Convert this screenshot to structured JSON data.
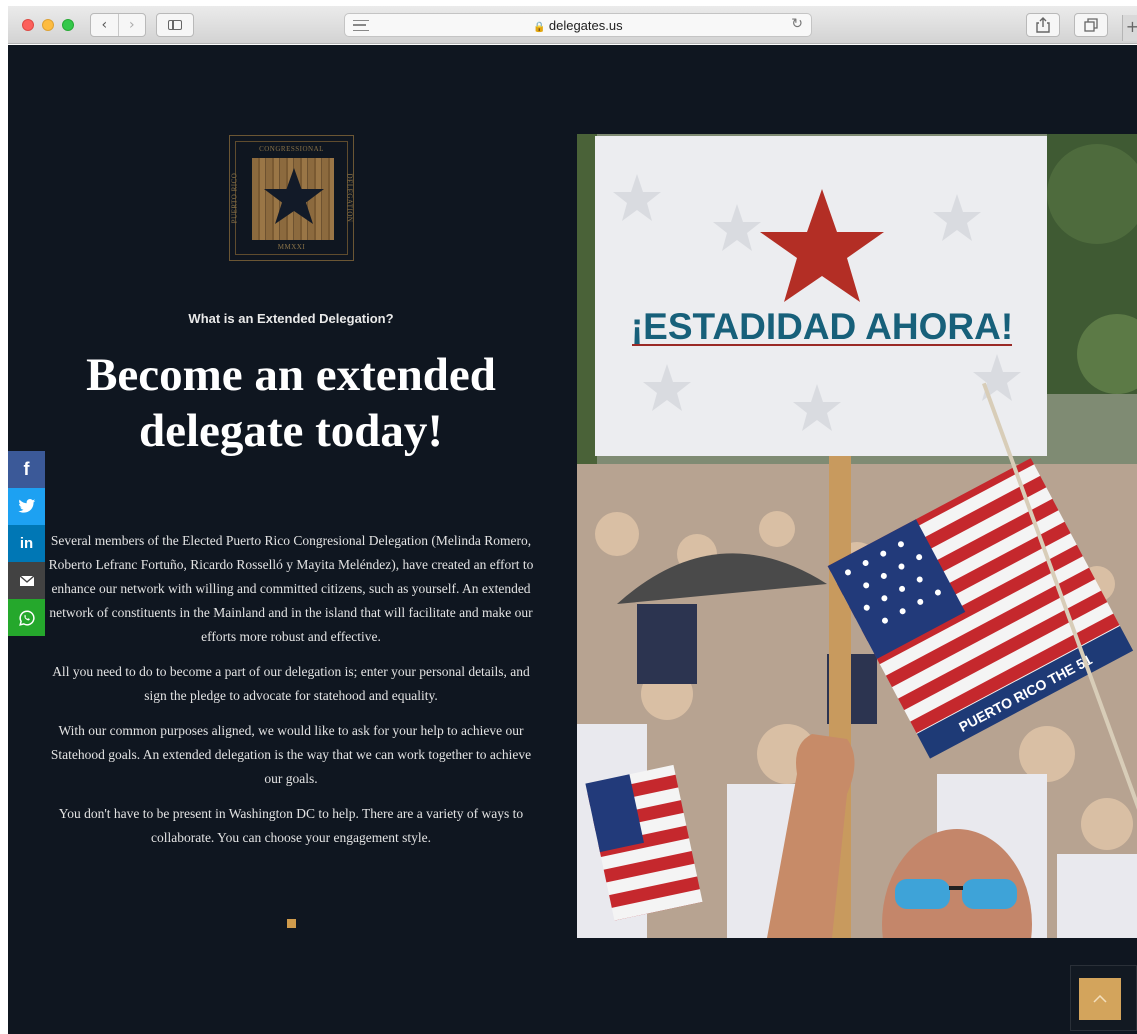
{
  "browser": {
    "url": "delegates.us",
    "back_glyph": "‹",
    "forward_glyph": "›",
    "reload_glyph": "↻",
    "plus_glyph": "+"
  },
  "logo": {
    "top": "CONGRESSIONAL",
    "left": "PUERTO RICO",
    "right": "DELEGATION",
    "bottom": "MMXXI"
  },
  "hero": {
    "eyebrow": "What is an Extended Delegation?",
    "headline_line1": "Become an extended",
    "headline_line2": "delegate today!"
  },
  "body": {
    "p1": "Several members of the Elected Puerto Rico Congresional Delegation (Melinda Romero, Roberto Lefranc Fortuño, Ricardo Rosselló y Mayita Meléndez), have created an effort to enhance our network with willing and committed citizens, such as yourself. An extended network of constituents in the Mainland and in the island that will facilitate and make our efforts more robust and effective.",
    "p2": "All you need to do to become a part of our delegation is; enter your personal details, and sign the pledge to advocate for statehood and equality.",
    "p3": "With our common purposes aligned, we would like to ask for your help to achieve our Statehood goals.  An extended delegation is the way that we can work together to achieve our goals.",
    "p4": "You don't have to be present in Washington DC to help. There are a variety of ways to collaborate. You can choose your engagement style."
  },
  "social": {
    "facebook": "f",
    "linkedin": "in"
  },
  "photo": {
    "sign_text": "¡ESTADIDAD AHORA!",
    "banner_text": "PUERTO RICO THE 51"
  },
  "colors": {
    "page_bg": "#0f1620",
    "accent": "#cf9b4c"
  }
}
